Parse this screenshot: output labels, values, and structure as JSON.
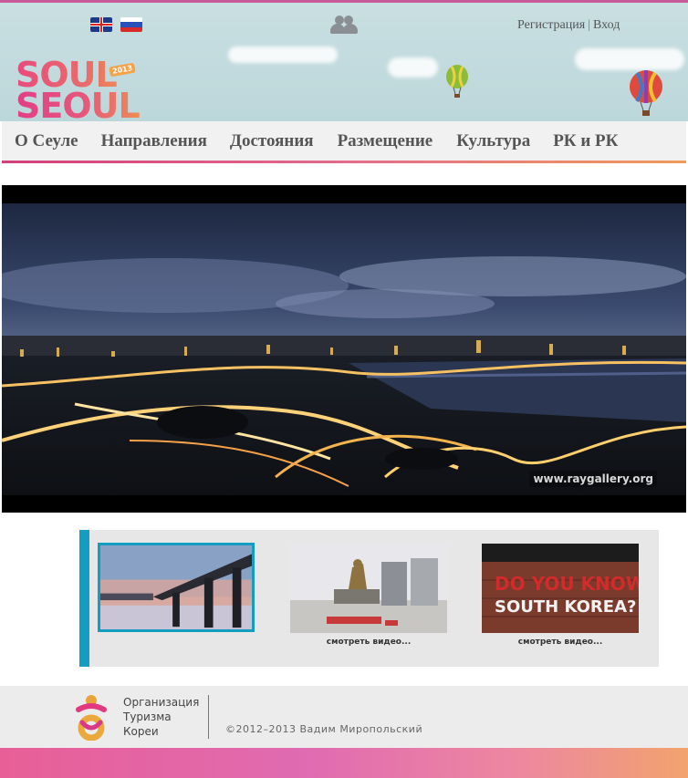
{
  "header": {
    "auth": {
      "register": "Регистрация",
      "separator": "|",
      "login": "Вход"
    },
    "logo": {
      "line1": "SOUL",
      "line2": "SEOUL",
      "badge": "2013"
    }
  },
  "nav": {
    "items": [
      {
        "label": "О Сеуле"
      },
      {
        "label": "Направления"
      },
      {
        "label": "Достояния"
      },
      {
        "label": "Размещение"
      },
      {
        "label": "Культура"
      },
      {
        "label": "РК и РК"
      }
    ]
  },
  "video": {
    "watermark": "www.raygallery.org"
  },
  "thumbnails": [
    {
      "caption": "",
      "active": true
    },
    {
      "caption": "смотреть видео...",
      "active": false
    },
    {
      "caption": "смотреть видео...",
      "active": false,
      "image_text": [
        "DO YOU KNOW",
        "SOUTH KOREA?"
      ]
    }
  ],
  "footer": {
    "org_lines": [
      "Организация",
      "Туризма",
      "Кореи"
    ],
    "copyright": "©2012–2013 Вадим Миропольский"
  },
  "colors": {
    "accent_blue": "#139ec1",
    "brand_pink": "#e23f86",
    "brand_orange": "#f0a24a"
  }
}
